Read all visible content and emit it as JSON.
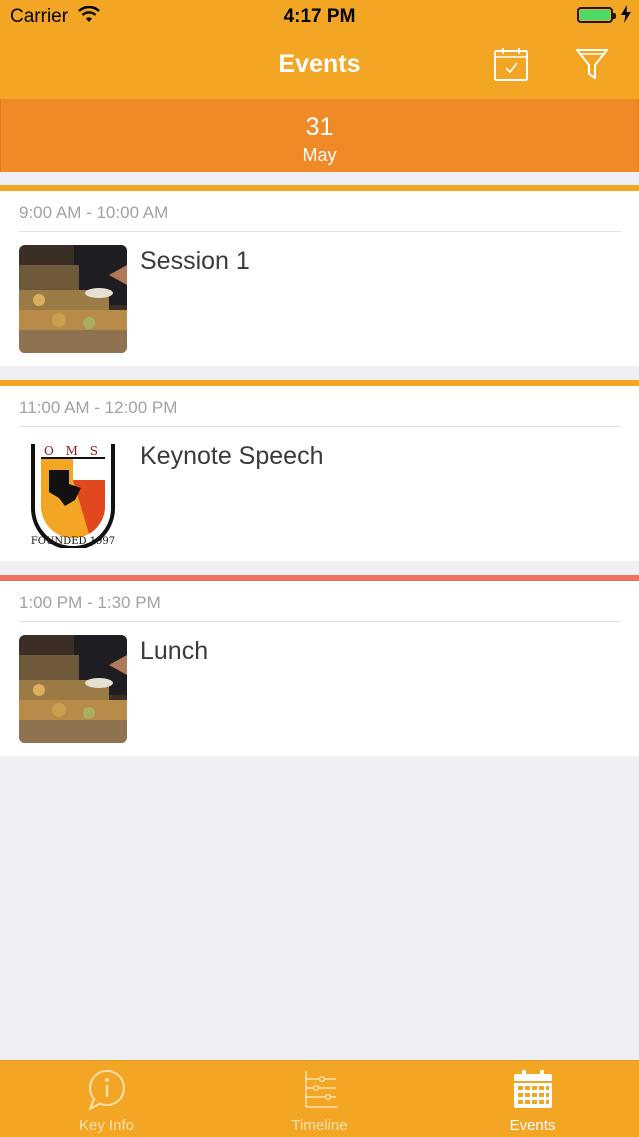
{
  "status": {
    "carrier": "Carrier",
    "time": "4:17 PM"
  },
  "nav": {
    "title": "Events"
  },
  "date": {
    "day": "31",
    "month": "May"
  },
  "events": [
    {
      "time": "9:00 AM - 10:00 AM",
      "title": "Session 1",
      "stripe": "#f2a623",
      "image": "buffet-photo"
    },
    {
      "time": "11:00 AM - 12:00 PM",
      "title": "Keynote Speech",
      "stripe": "#f2a623",
      "image": "oms-logo"
    },
    {
      "time": "1:00 PM - 1:30 PM",
      "title": "Lunch",
      "stripe": "#f27261",
      "image": "buffet-photo"
    }
  ],
  "logo": {
    "letters": "O M S",
    "founded": "FOUNDED 1997"
  },
  "tabs": [
    {
      "label": "Key Info",
      "icon": "info-bubble-icon",
      "selected": false
    },
    {
      "label": "Timeline",
      "icon": "timeline-icon",
      "selected": false
    },
    {
      "label": "Events",
      "icon": "calendar-grid-icon",
      "selected": true
    }
  ],
  "colors": {
    "accent": "#f2a623",
    "date_bar": "#ef8a26",
    "tab_inactive": "#fbe0b0",
    "tab_active": "#ffffff"
  }
}
